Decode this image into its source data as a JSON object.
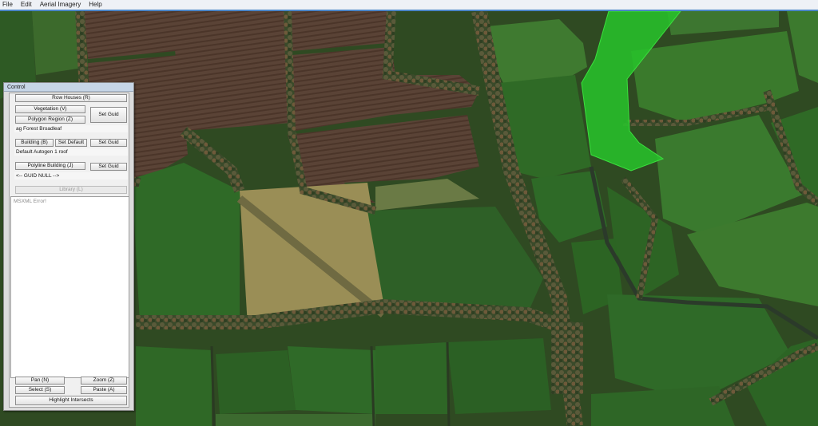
{
  "menu": [
    "File",
    "Edit",
    "Aerial Imagery",
    "Help"
  ],
  "control": {
    "title": "Control",
    "row_houses": "Row Houses (R)",
    "vegetation": "Vegetation (V)",
    "set_guid": "Set Guid",
    "polygon_region": "Polygon Region (Z)",
    "vegetation_value": "ag Forest Broadleaf",
    "building": "Building (B)",
    "set_default": "Set Default",
    "building_value": "Default Autogen 1 roof",
    "polyline_building": "Polyline Building (J)",
    "guid_value": "<-- GUID NULL -->",
    "library": "Library (L)",
    "output_text": "MSXML Error!",
    "pan": "Pan (N)",
    "zoom": "Zoom (Z)",
    "select": "Select (S)",
    "paste": "Paste (A)",
    "highlight": "Highlight Intersects"
  },
  "colors": {
    "selection_polygon": "#27c42a",
    "panel_bg": "#dcdcdc",
    "title_bar": "#c6d5e6"
  }
}
